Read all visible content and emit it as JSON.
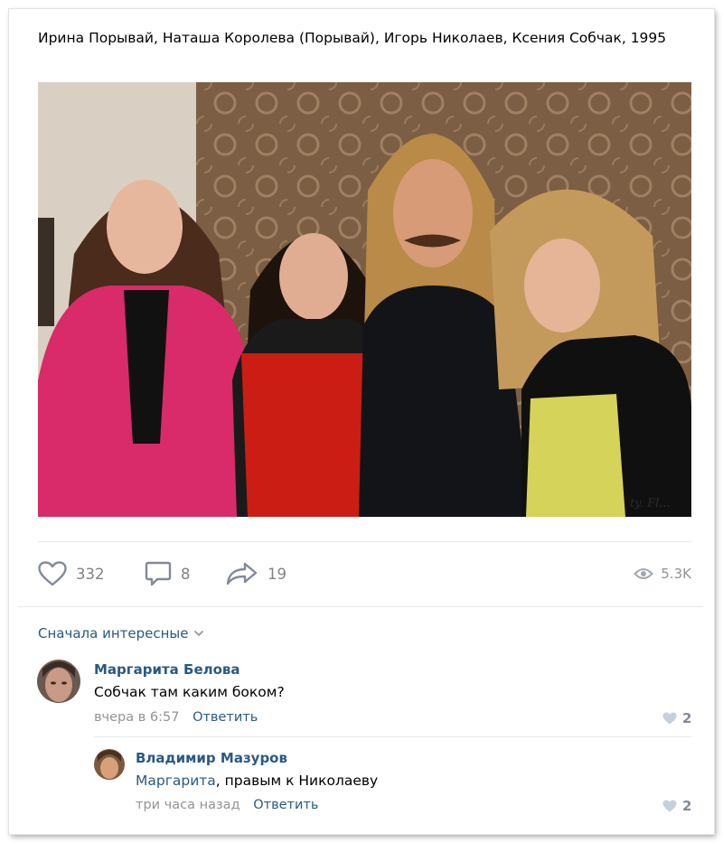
{
  "post": {
    "text": "Ирина Порывай, Наташа Королева (Порывай), Игорь Николаев, Ксения Собчак, 1995",
    "photo_watermark": "ty. Fl..."
  },
  "actions": {
    "likes": "332",
    "comments": "8",
    "shares": "19",
    "views": "5.3K"
  },
  "comments_sort": {
    "label": "Сначала интересные"
  },
  "comments": [
    {
      "author": "Маргарита Белова",
      "text": "Собчак там каким боком?",
      "time": "вчера в 6:57",
      "reply_label": "Ответить",
      "likes": "2"
    },
    {
      "author": "Владимир Мазуров",
      "mention": "Маргарита",
      "text": ", правым к Николаеву",
      "time": "три часа назад",
      "reply_label": "Ответить",
      "likes": "2"
    }
  ],
  "colors": {
    "link": "#2a5885",
    "muted": "#939393",
    "icon": "#828a99"
  }
}
